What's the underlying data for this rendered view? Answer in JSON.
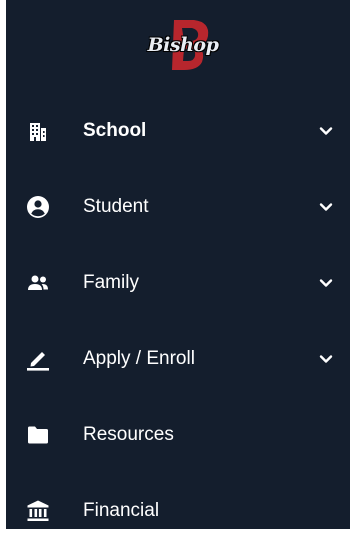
{
  "colors": {
    "panel_bg": "#141e2d",
    "text": "#ffffff",
    "logo_accent": "#c0272d"
  },
  "logo": {
    "text": "Bishop",
    "alt_name": "bishop-logo"
  },
  "menu": {
    "items": [
      {
        "label": "School",
        "icon": "school-building-icon",
        "expandable": true,
        "active": true
      },
      {
        "label": "Student",
        "icon": "user-circle-icon",
        "expandable": true,
        "active": false
      },
      {
        "label": "Family",
        "icon": "family-group-icon",
        "expandable": true,
        "active": false
      },
      {
        "label": "Apply / Enroll",
        "icon": "pencil-icon",
        "expandable": true,
        "active": false
      },
      {
        "label": "Resources",
        "icon": "folder-icon",
        "expandable": false,
        "active": false
      },
      {
        "label": "Financial",
        "icon": "bank-icon",
        "expandable": false,
        "active": false
      }
    ]
  }
}
